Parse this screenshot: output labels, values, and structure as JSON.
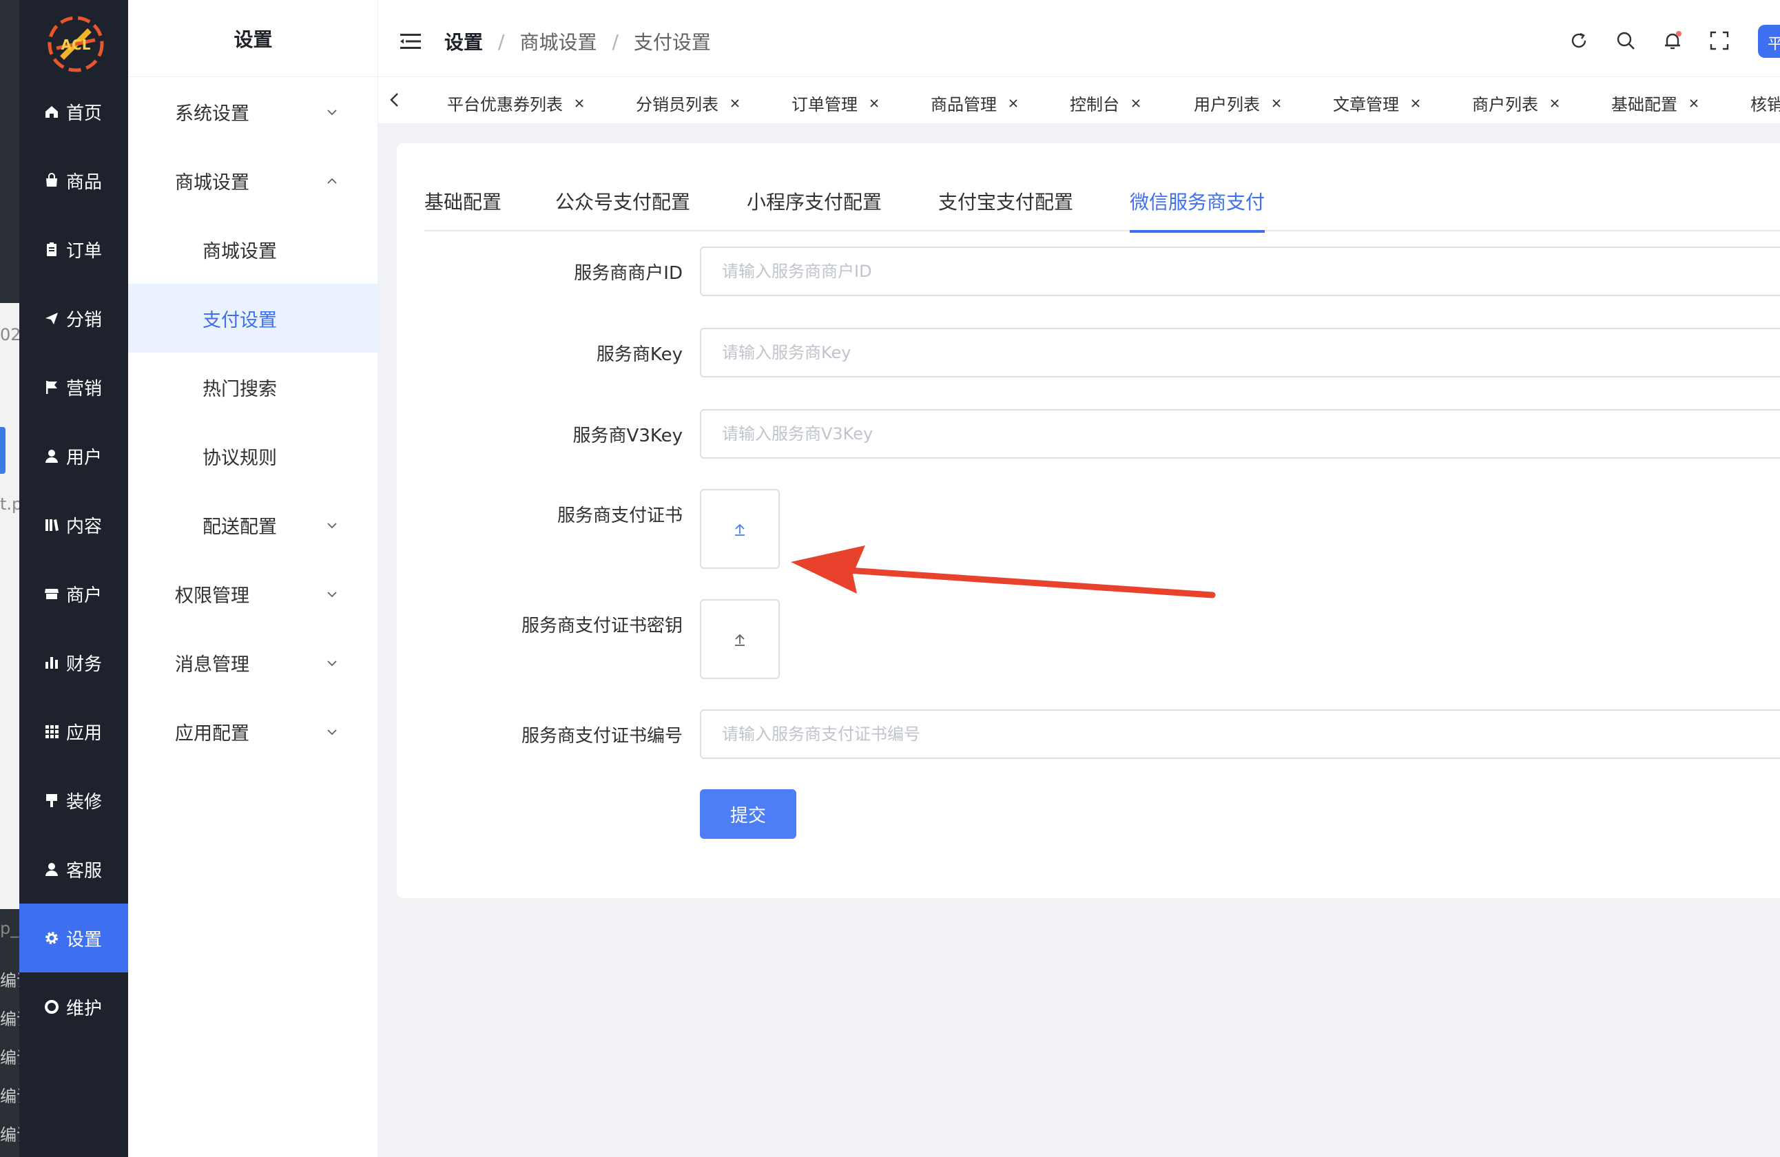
{
  "background_window": {
    "fragments": [
      "02",
      "t.p",
      "p_",
      "编译",
      "编译",
      "编译",
      "编译",
      "编译"
    ]
  },
  "sidebar": {
    "logo_text": "ACL",
    "items": [
      {
        "label": "首页",
        "icon": "home-icon"
      },
      {
        "label": "商品",
        "icon": "bag-icon"
      },
      {
        "label": "订单",
        "icon": "clipboard-icon"
      },
      {
        "label": "分销",
        "icon": "paper-plane-icon"
      },
      {
        "label": "营销",
        "icon": "flag-icon"
      },
      {
        "label": "用户",
        "icon": "user-icon"
      },
      {
        "label": "内容",
        "icon": "book-icon"
      },
      {
        "label": "商户",
        "icon": "store-icon"
      },
      {
        "label": "财务",
        "icon": "bar-chart-icon"
      },
      {
        "label": "应用",
        "icon": "grid-icon"
      },
      {
        "label": "装修",
        "icon": "brush-icon"
      },
      {
        "label": "客服",
        "icon": "headset-user-icon"
      },
      {
        "label": "设置",
        "icon": "gear-icon"
      },
      {
        "label": "维护",
        "icon": "lifebuoy-icon"
      }
    ],
    "active_index": 12
  },
  "submenu": {
    "title": "设置",
    "items": [
      {
        "label": "系统设置",
        "level": 1,
        "chevron": "down"
      },
      {
        "label": "商城设置",
        "level": 1,
        "chevron": "up"
      },
      {
        "label": "商城设置",
        "level": 2
      },
      {
        "label": "支付设置",
        "level": 2,
        "active": true
      },
      {
        "label": "热门搜索",
        "level": 2
      },
      {
        "label": "协议规则",
        "level": 2
      },
      {
        "label": "配送配置",
        "level": 2,
        "chevron": "down"
      },
      {
        "label": "权限管理",
        "level": 1,
        "chevron": "down"
      },
      {
        "label": "消息管理",
        "level": 1,
        "chevron": "down"
      },
      {
        "label": "应用配置",
        "level": 1,
        "chevron": "down"
      }
    ]
  },
  "header": {
    "breadcrumb": [
      "设置",
      "商城设置",
      "支付设置"
    ],
    "separator": "/",
    "avatar_text": "平"
  },
  "tabs_bar": {
    "tabs": [
      "平台优惠券列表",
      "分销员列表",
      "订单管理",
      "商品管理",
      "控制台",
      "用户列表",
      "文章管理",
      "商户列表",
      "基础配置",
      "核销"
    ]
  },
  "content": {
    "tabs": [
      "基础配置",
      "公众号支付配置",
      "小程序支付配置",
      "支付宝支付配置",
      "微信服务商支付"
    ],
    "active_tab": 4,
    "form": {
      "merchant_id": {
        "label": "服务商商户ID",
        "placeholder": "请输入服务商商户ID",
        "value": ""
      },
      "key": {
        "label": "服务商Key",
        "placeholder": "请输入服务商Key",
        "value": ""
      },
      "v3key": {
        "label": "服务商V3Key",
        "placeholder": "请输入服务商V3Key",
        "value": ""
      },
      "cert": {
        "label": "服务商支付证书"
      },
      "cert_key": {
        "label": "服务商支付证书密钥"
      },
      "cert_no": {
        "label": "服务商支付证书编号",
        "placeholder": "请输入服务商支付证书编号",
        "value": ""
      },
      "submit_label": "提交"
    }
  },
  "colors": {
    "accent": "#3e6ff0",
    "sidebar_bg": "#1e222d",
    "annotation_arrow": "#e8412c"
  }
}
